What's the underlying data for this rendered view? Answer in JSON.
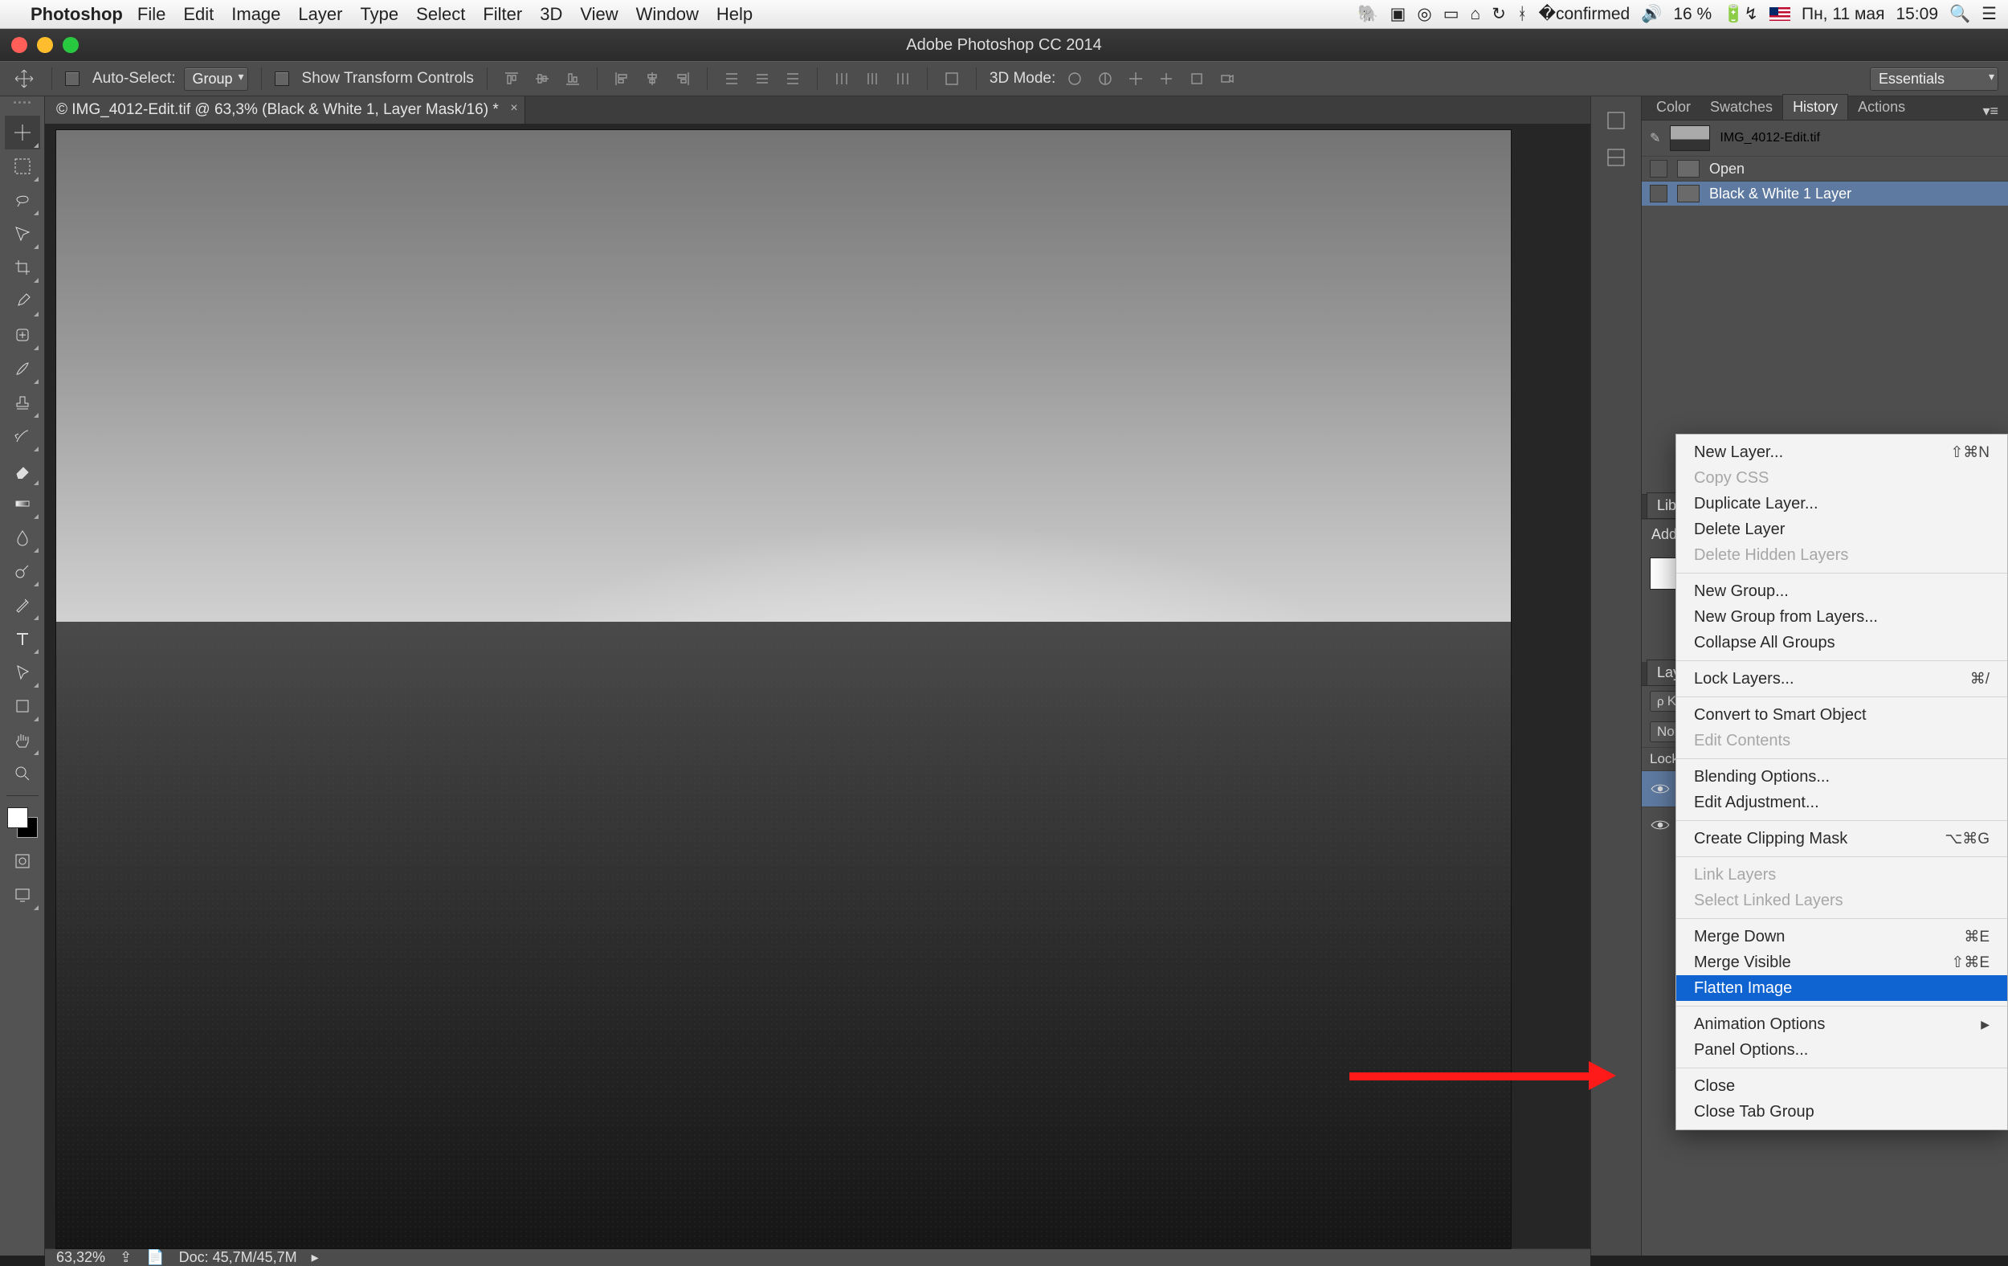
{
  "mac_menu": {
    "app": "Photoshop",
    "items": [
      "File",
      "Edit",
      "Image",
      "Layer",
      "Type",
      "Select",
      "Filter",
      "3D",
      "View",
      "Window",
      "Help"
    ],
    "battery": "16 %",
    "date": "Пн, 11 мая",
    "time": "15:09"
  },
  "window": {
    "title": "Adobe Photoshop CC 2014"
  },
  "options": {
    "auto_select": "Auto-Select:",
    "group": "Group",
    "show_transform": "Show Transform Controls",
    "mode3d": "3D Mode:",
    "workspace": "Essentials"
  },
  "document": {
    "tab": "© IMG_4012-Edit.tif @ 63,3% (Black & White 1, Layer Mask/16) *",
    "zoom": "63,32%",
    "doc_info": "Doc: 45,7M/45,7M"
  },
  "panel_tabs": {
    "color": "Color",
    "swatches": "Swatches",
    "history": "History",
    "actions": "Actions",
    "libraries": "Librari",
    "layers": "Layers"
  },
  "history": {
    "filename": "IMG_4012-Edit.tif",
    "items": [
      {
        "label": "Open",
        "selected": false
      },
      {
        "label": "Black & White 1 Layer",
        "selected": true
      }
    ]
  },
  "libraries": {
    "add": "Add an"
  },
  "layers": {
    "kind": "Kind",
    "blend": "Norma",
    "lock": "Lock:"
  },
  "context_menu": {
    "items": [
      {
        "label": "New Layer...",
        "shortcut": "⇧⌘N"
      },
      {
        "label": "Copy CSS",
        "disabled": true
      },
      {
        "label": "Duplicate Layer..."
      },
      {
        "label": "Delete Layer"
      },
      {
        "label": "Delete Hidden Layers",
        "disabled": true
      },
      {
        "sep": true
      },
      {
        "label": "New Group..."
      },
      {
        "label": "New Group from Layers..."
      },
      {
        "label": "Collapse All Groups"
      },
      {
        "sep": true
      },
      {
        "label": "Lock Layers...",
        "shortcut": "⌘/"
      },
      {
        "sep": true
      },
      {
        "label": "Convert to Smart Object"
      },
      {
        "label": "Edit Contents",
        "disabled": true
      },
      {
        "sep": true
      },
      {
        "label": "Blending Options..."
      },
      {
        "label": "Edit Adjustment..."
      },
      {
        "sep": true
      },
      {
        "label": "Create Clipping Mask",
        "shortcut": "⌥⌘G"
      },
      {
        "sep": true
      },
      {
        "label": "Link Layers",
        "disabled": true
      },
      {
        "label": "Select Linked Layers",
        "disabled": true
      },
      {
        "sep": true
      },
      {
        "label": "Merge Down",
        "shortcut": "⌘E"
      },
      {
        "label": "Merge Visible",
        "shortcut": "⇧⌘E"
      },
      {
        "label": "Flatten Image",
        "selected": true
      },
      {
        "sep": true
      },
      {
        "label": "Animation Options",
        "submenu": true
      },
      {
        "label": "Panel Options..."
      },
      {
        "sep": true
      },
      {
        "label": "Close"
      },
      {
        "label": "Close Tab Group"
      }
    ]
  }
}
